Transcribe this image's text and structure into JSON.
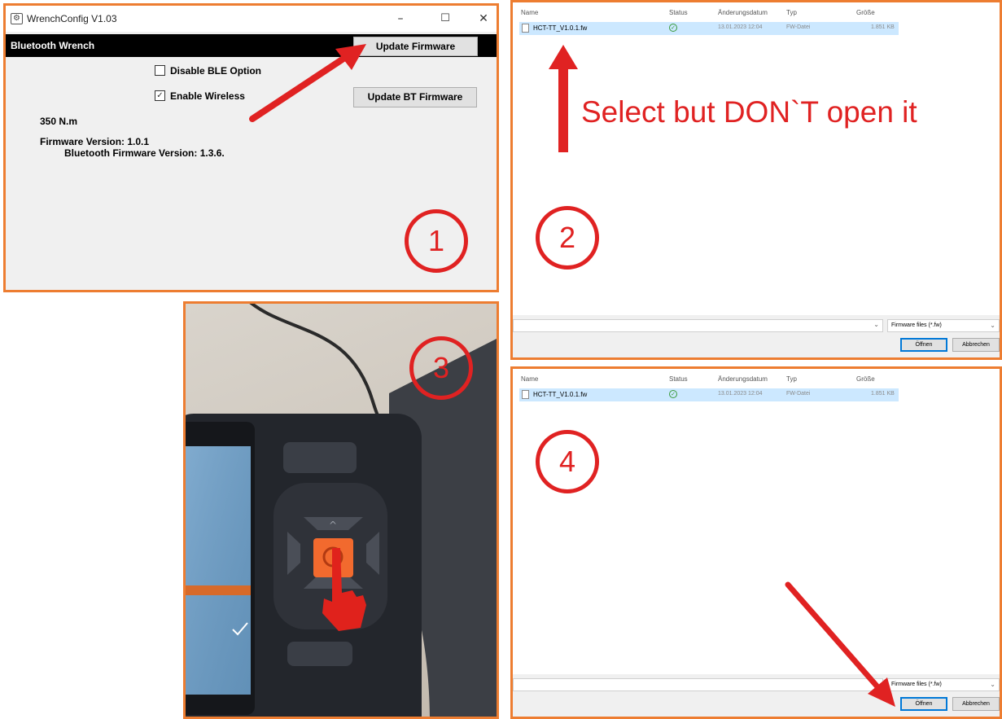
{
  "panel1": {
    "window_title": "WrenchConfig V1.03",
    "app_icon": "wrench-app-icon",
    "window_controls": {
      "minimize": "–",
      "maximize": "☐",
      "close": "✕"
    },
    "bar_label": "Bluetooth Wrench",
    "update_firmware_button": "Update Firmware",
    "update_bt_firmware_button": "Update BT Firmware",
    "checkboxes": [
      {
        "label": "Disable BLE Option",
        "checked": false
      },
      {
        "label": "Enable Wireless",
        "checked": true
      }
    ],
    "torque": "350 N.m",
    "firmware_version": "Firmware Version: 1.0.1",
    "bt_firmware_version": "Bluetooth Firmware Version: 1.3.6.",
    "step": "1"
  },
  "dialog_columns": {
    "name": "Name",
    "status": "Status",
    "date": "Änderungsdatum",
    "type": "Typ",
    "size": "Größe"
  },
  "file": {
    "name": "HCT-TT_V1.0.1.fw",
    "date": "13.01.2023 12:04",
    "type": "FW-Datei",
    "size": "1.851 KB",
    "status_icon": "check-circle-icon"
  },
  "dialog": {
    "filter": "Firmware files (*.fw)",
    "open_button": "Öffnen",
    "cancel_button": "Abbrechen"
  },
  "panel2": {
    "instruction": "Select but DON`T open it",
    "step": "2"
  },
  "panel3": {
    "step": "3",
    "photo_subject": "hand pressing orange OK button on wrench device"
  },
  "panel4": {
    "step": "4"
  },
  "colors": {
    "annotation_red": "#e02222",
    "panel_border": "#ed7d31",
    "selection_blue": "#cce8ff",
    "device_button_orange": "#f26a2e"
  }
}
